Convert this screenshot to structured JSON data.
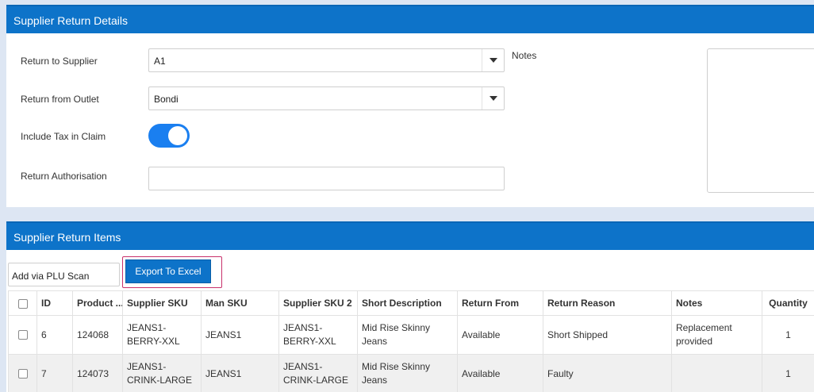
{
  "details": {
    "header": "Supplier Return Details",
    "return_to_supplier_label": "Return to Supplier",
    "return_to_supplier_value": "A1",
    "return_from_outlet_label": "Return from Outlet",
    "return_from_outlet_value": "Bondi",
    "include_tax_label": "Include Tax in Claim",
    "include_tax_enabled": true,
    "return_authorisation_label": "Return Authorisation",
    "return_authorisation_value": "",
    "notes_label": "Notes",
    "notes_value": ""
  },
  "items": {
    "header": "Supplier Return Items",
    "plu_scan_value": "Add via PLU Scan",
    "export_label": "Export To Excel",
    "columns": [
      "ID",
      "Product ...",
      "Supplier SKU",
      "Man SKU",
      "Supplier SKU 2",
      "Short Description",
      "Return From",
      "Return Reason",
      "Notes",
      "Quantity"
    ],
    "rows": [
      {
        "id": "6",
        "product": "124068",
        "supplier_sku": "JEANS1-BERRY-XXL",
        "man_sku": "JEANS1",
        "supplier_sku2": "JEANS1-BERRY-XXL",
        "short_description": "Mid Rise Skinny Jeans",
        "return_from": "Available",
        "return_reason": "Short Shipped",
        "notes": "Replacement provided",
        "quantity": "1"
      },
      {
        "id": "7",
        "product": "124073",
        "supplier_sku": "JEANS1-CRINK-LARGE",
        "man_sku": "JEANS1",
        "supplier_sku2": "JEANS1-CRINK-LARGE",
        "short_description": "Mid Rise Skinny Jeans",
        "return_from": "Available",
        "return_reason": "Faulty",
        "notes": "",
        "quantity": "1"
      }
    ]
  },
  "colors": {
    "header_blue": "#0d73c9",
    "toggle_blue": "#1a7ff0",
    "highlight_border": "#c8306b",
    "page_background": "#dde6f3"
  },
  "icons": {
    "select_arrow": "caret-down-icon",
    "toggle": "toggle-switch"
  }
}
